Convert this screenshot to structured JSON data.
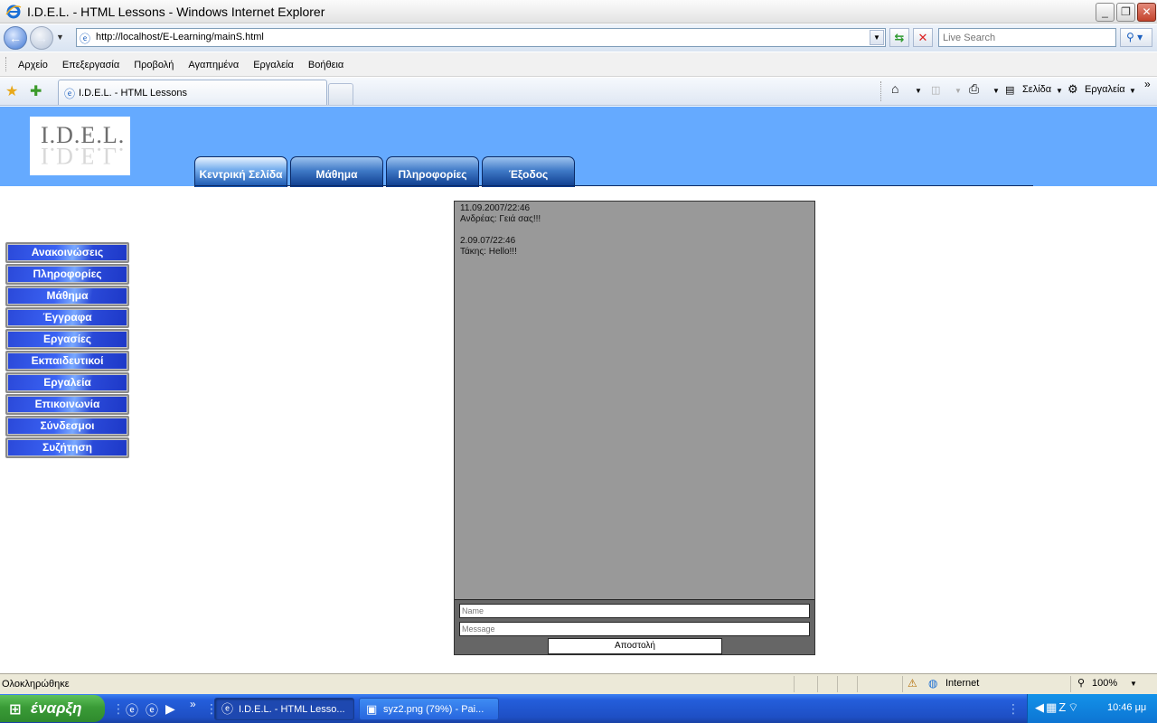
{
  "window": {
    "title": "I.D.E.L. - HTML Lessons - Windows Internet Explorer",
    "min_glyph": "_",
    "max_glyph": "❐",
    "close_glyph": "✕"
  },
  "address": {
    "url": "http://localhost/E-Learning/mainS.html",
    "search_placeholder": "Live Search"
  },
  "menu": [
    "Αρχείο",
    "Επεξεργασία",
    "Προβολή",
    "Αγαπημένα",
    "Εργαλεία",
    "Βοήθεια"
  ],
  "tabs": {
    "active_title": "I.D.E.L. - HTML Lessons",
    "page_menu": "Σελίδα",
    "tools_menu": "Εργαλεία"
  },
  "page": {
    "logo_text": "I.D.E.L.",
    "top_nav": [
      "Κεντρική Σελίδα",
      "Μάθημα",
      "Πληροφορίες",
      "Έξοδος"
    ],
    "side_menu": [
      "Ανακοινώσεις",
      "Πληροφορίες",
      "Μάθημα",
      "Έγγραφα",
      "Εργασίες",
      "Εκπαιδευτικοί",
      "Εργαλεία",
      "Επικοινωνία",
      "Σύνδεσμοι",
      "Συζήτηση"
    ],
    "chat": {
      "messages": [
        {
          "time": "11.09.2007/22:46",
          "text": "Ανδρέας: Γειά σας!!!"
        },
        {
          "time": "2.09.07/22:46",
          "text": "Τάκης: Hello!!!"
        }
      ],
      "name_placeholder": "Name",
      "message_placeholder": "Message",
      "send_label": "Αποστολή"
    }
  },
  "status": {
    "text": "Ολοκληρώθηκε",
    "zone": "Internet",
    "zoom": "100%"
  },
  "taskbar": {
    "start_label": "έναρξη",
    "items": [
      "I.D.E.L. - HTML Lesso...",
      "syz2.png (79%) - Pai..."
    ],
    "clock": "10:46 μμ"
  },
  "colors": {
    "header_bg": "#65aaff",
    "chat_bg": "#999999",
    "chat_form_bg": "#666666"
  }
}
